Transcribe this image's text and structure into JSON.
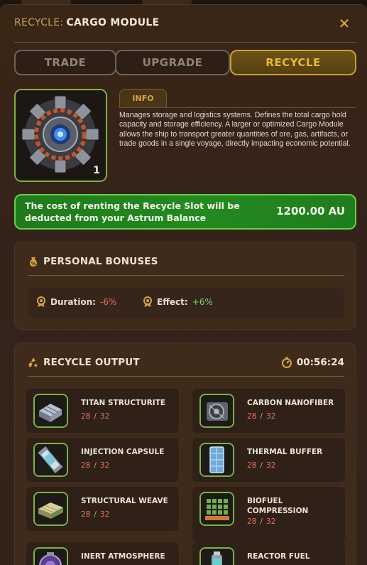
{
  "header": {
    "prefix": "RECYCLE:",
    "title": "CARGO MODULE",
    "close_icon": "close-icon"
  },
  "tabs": [
    {
      "label": "TRADE",
      "active": false
    },
    {
      "label": "UPGRADE",
      "active": false
    },
    {
      "label": "RECYCLE",
      "active": true
    }
  ],
  "module": {
    "count": "1",
    "info_tab": "INFO",
    "description": "Manages storage and logistics systems. Defines the total cargo hold capacity and storage efficiency. A larger or optimized Cargo Module allows the ship to transport greater quantities of ore, gas, artifacts, or trade goods in a single voyage, directly impacting economic potential."
  },
  "cost": {
    "message": "The cost of renting the Recycle Slot will be deducted from your Astrum Balance",
    "amount": "1200.00 AU"
  },
  "bonuses": {
    "title": "PERSONAL BONUSES",
    "duration_label": "Duration:",
    "duration_value": "-6%",
    "effect_label": "Effect:",
    "effect_value": "+6%"
  },
  "output": {
    "title": "RECYCLE OUTPUT",
    "timer": "00:56:24",
    "items": [
      {
        "name": "TITAN STRUCTURITE",
        "have": "28",
        "sep": "/",
        "need": "32"
      },
      {
        "name": "CARBON NANOFIBER",
        "have": "28",
        "sep": "/",
        "need": "32"
      },
      {
        "name": "INJECTION CAPSULE",
        "have": "28",
        "sep": "/",
        "need": "32"
      },
      {
        "name": "THERMAL BUFFER",
        "have": "28",
        "sep": "/",
        "need": "32"
      },
      {
        "name": "STRUCTURAL WEAVE",
        "have": "28",
        "sep": "/",
        "need": "32"
      },
      {
        "name": "BIOFUEL COMPRESSION",
        "have": "28",
        "sep": "/",
        "need": "32"
      },
      {
        "name": "INERT ATMOSPHERE",
        "have": "",
        "sep": "",
        "need": ""
      },
      {
        "name": "REACTOR FUEL",
        "have": "",
        "sep": "",
        "need": ""
      }
    ]
  },
  "colors": {
    "accent_gold": "#d4a63c",
    "cost_green": "#238a1f",
    "negative": "#e8705c",
    "positive": "#7ad36a"
  }
}
